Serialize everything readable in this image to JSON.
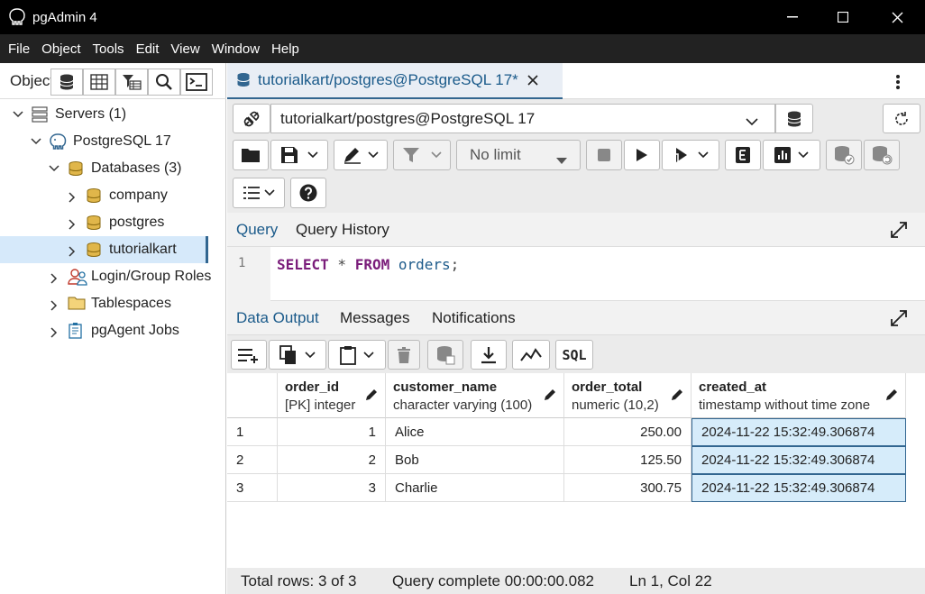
{
  "window": {
    "title": "pgAdmin 4"
  },
  "menu": [
    "File",
    "Object",
    "Tools",
    "Edit",
    "View",
    "Window",
    "Help"
  ],
  "left": {
    "label": "Object",
    "tree": [
      {
        "label": "Servers (1)"
      },
      {
        "label": "PostgreSQL 17"
      },
      {
        "label": "Databases (3)"
      },
      {
        "label": "company"
      },
      {
        "label": "postgres"
      },
      {
        "label": "tutorialkart"
      },
      {
        "label": "Login/Group Roles"
      },
      {
        "label": "Tablespaces"
      },
      {
        "label": "pgAgent Jobs"
      }
    ]
  },
  "tab": {
    "label": "tutorialkart/postgres@PostgreSQL 17*"
  },
  "connection": {
    "value": "tutorialkart/postgres@PostgreSQL 17"
  },
  "limit": {
    "value": "No limit"
  },
  "query_tabs": [
    "Query",
    "Query History"
  ],
  "editor": {
    "line": "1",
    "kw1": "SELECT",
    "op": " * ",
    "kw2": "FROM",
    "ident": " orders",
    "end": ";"
  },
  "output_tabs": [
    "Data Output",
    "Messages",
    "Notifications"
  ],
  "grid": {
    "columns": [
      {
        "name": "order_id",
        "type": "[PK] integer"
      },
      {
        "name": "customer_name",
        "type": "character varying (100)"
      },
      {
        "name": "order_total",
        "type": "numeric (10,2)"
      },
      {
        "name": "created_at",
        "type": "timestamp without time zone"
      }
    ],
    "rows": [
      {
        "rn": "1",
        "order_id": "1",
        "customer_name": "Alice",
        "order_total": "250.00",
        "created_at": "2024-11-22 15:32:49.306874"
      },
      {
        "rn": "2",
        "order_id": "2",
        "customer_name": "Bob",
        "order_total": "125.50",
        "created_at": "2024-11-22 15:32:49.306874"
      },
      {
        "rn": "3",
        "order_id": "3",
        "customer_name": "Charlie",
        "order_total": "300.75",
        "created_at": "2024-11-22 15:32:49.306874"
      }
    ]
  },
  "status": {
    "rows": "Total rows: 3 of 3",
    "query": "Query complete 00:00:00.082",
    "pos": "Ln 1, Col 22"
  },
  "outtoolbar": {
    "sql_label": "SQL"
  },
  "colors": {
    "accent": "#326690",
    "selection": "#d6e9fa",
    "keyword": "#7a1c7a",
    "identifier": "#1c5a8a"
  }
}
